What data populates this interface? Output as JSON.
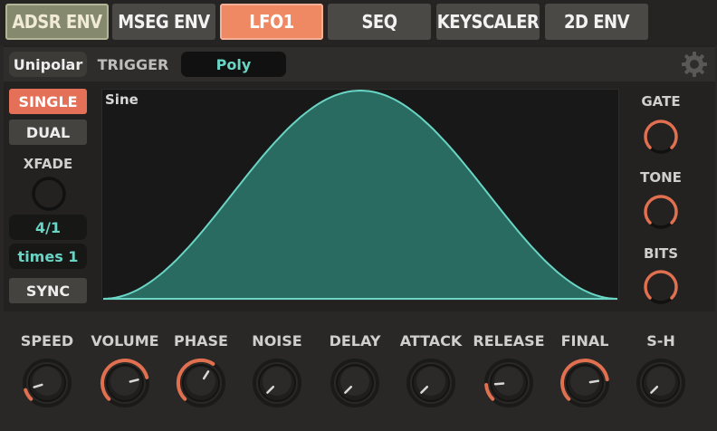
{
  "tabs": [
    {
      "label": "ADSR ENV"
    },
    {
      "label": "MSEG ENV"
    },
    {
      "label": "LFO1"
    },
    {
      "label": "SEQ"
    },
    {
      "label": "KEYSCALER"
    },
    {
      "label": "2D ENV"
    }
  ],
  "subbar": {
    "polarity": "Unipolar",
    "trigger_label": "TRIGGER",
    "trigger_mode": "Poly"
  },
  "left": {
    "single": "SINGLE",
    "dual": "DUAL",
    "xfade_label": "XFADE",
    "rate": "4/1",
    "multiplier": "times 1",
    "sync": "SYNC"
  },
  "waveform": {
    "label": "Sine"
  },
  "right": {
    "gate": "GATE",
    "tone": "TONE",
    "bits": "BITS"
  },
  "knobs": [
    {
      "label": "SPEED",
      "value": 0.1
    },
    {
      "label": "VOLUME",
      "value": 0.78
    },
    {
      "label": "PHASE",
      "value": 0.62
    },
    {
      "label": "NOISE",
      "value": 0.0
    },
    {
      "label": "DELAY",
      "value": 0.0
    },
    {
      "label": "ATTACK",
      "value": 0.0
    },
    {
      "label": "RELEASE",
      "value": 0.15
    },
    {
      "label": "FINAL",
      "value": 0.8
    },
    {
      "label": "S-H",
      "value": 0.0
    }
  ],
  "colors": {
    "accent": "#ee8963",
    "teal": "#6ad4c5",
    "arc": "#e07050"
  }
}
